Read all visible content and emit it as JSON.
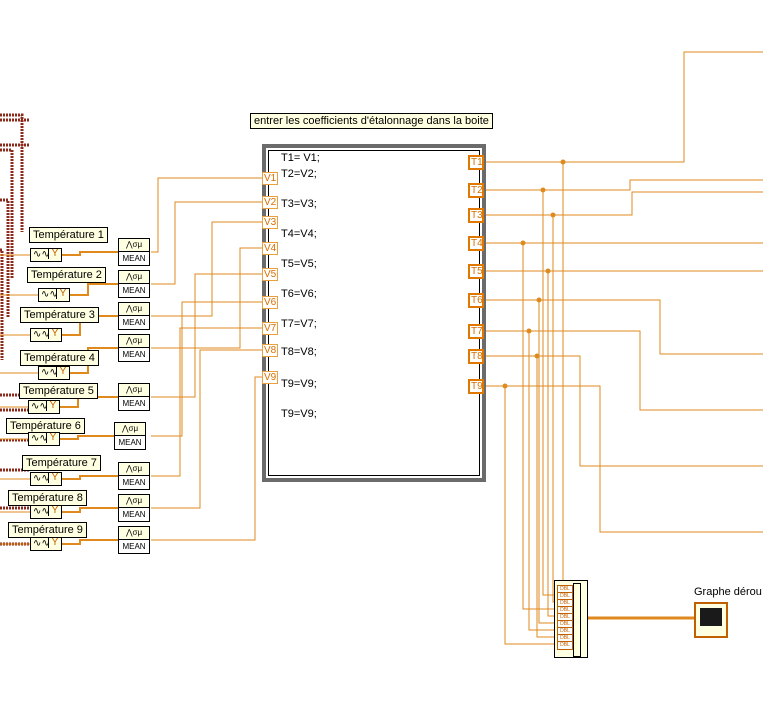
{
  "diagram": {
    "note_label": "entrer les coefficients d'étalonnage dans la boite",
    "graph_label": "Graphe dérou",
    "temperature_labels": [
      "Température 1",
      "Température 2",
      "Température 3",
      "Température 4",
      "Température 5",
      "Température 6",
      "Température 7",
      "Température 8",
      "Température 9"
    ],
    "formula_lines": [
      "T1= V1;",
      "T2=V2;",
      "T3=V3;",
      "T4=V4;",
      "T5=V5;",
      "T6=V6;",
      "T7=V7;",
      "T8=V8;",
      "T9=V9;",
      "T9=V9;"
    ],
    "inputs": [
      "V1",
      "V2",
      "V3",
      "V4",
      "V5",
      "V6",
      "V7",
      "V8",
      "V9"
    ],
    "outputs": [
      "T1",
      "T2",
      "T3",
      "T4",
      "T5",
      "T6",
      "T7",
      "T8",
      "T9"
    ],
    "mean_label": "MEAN",
    "mean_icon_text": "⋀σμ",
    "wave_icon_text": "∿∿",
    "y_label": "Y",
    "dbl_label": "DBL",
    "wire_color": "#e08a1e",
    "frame_color": "#6b6b6b"
  }
}
